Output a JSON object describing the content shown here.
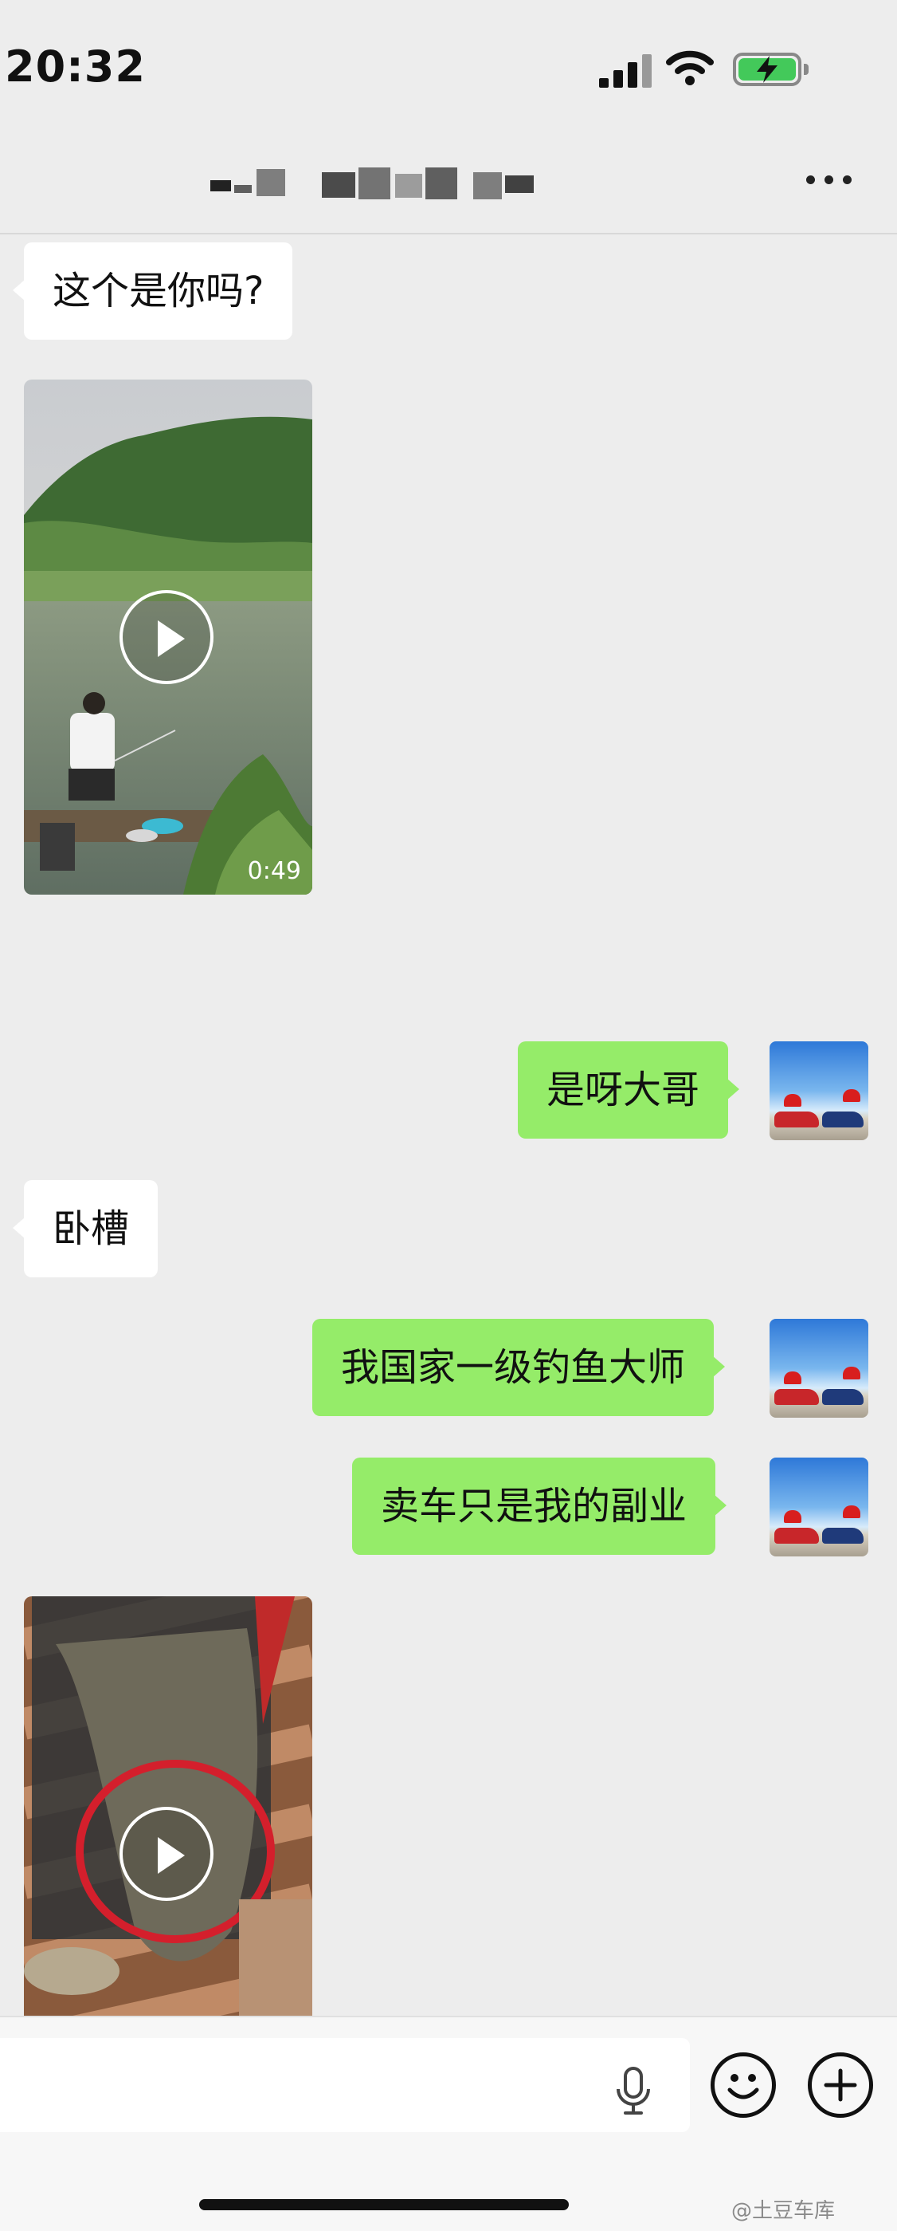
{
  "status_bar": {
    "time": "20:32"
  },
  "chat": {
    "messages": [
      {
        "side": "incoming",
        "type": "text",
        "text": "这个是你吗?"
      },
      {
        "side": "incoming",
        "type": "video",
        "duration": "0:49"
      },
      {
        "side": "outgoing",
        "type": "text",
        "text": "是呀大哥"
      },
      {
        "side": "incoming",
        "type": "text",
        "text": "卧槽"
      },
      {
        "side": "outgoing",
        "type": "text",
        "text": "我国家一级钓鱼大师"
      },
      {
        "side": "outgoing",
        "type": "text",
        "text": "卖车只是我的副业"
      },
      {
        "side": "incoming",
        "type": "video"
      }
    ]
  },
  "icons": {
    "header_more": "more-dots-icon",
    "voice": "microphone-icon",
    "emoji": "emoji-icon",
    "more_actions": "plus-icon",
    "video_play": "play-icon"
  },
  "colors": {
    "outgoing_bubble": "#95ec69",
    "incoming_bubble": "#ffffff",
    "background": "#ededed",
    "battery_fill": "#43c95a"
  },
  "watermark": "@土豆车库"
}
